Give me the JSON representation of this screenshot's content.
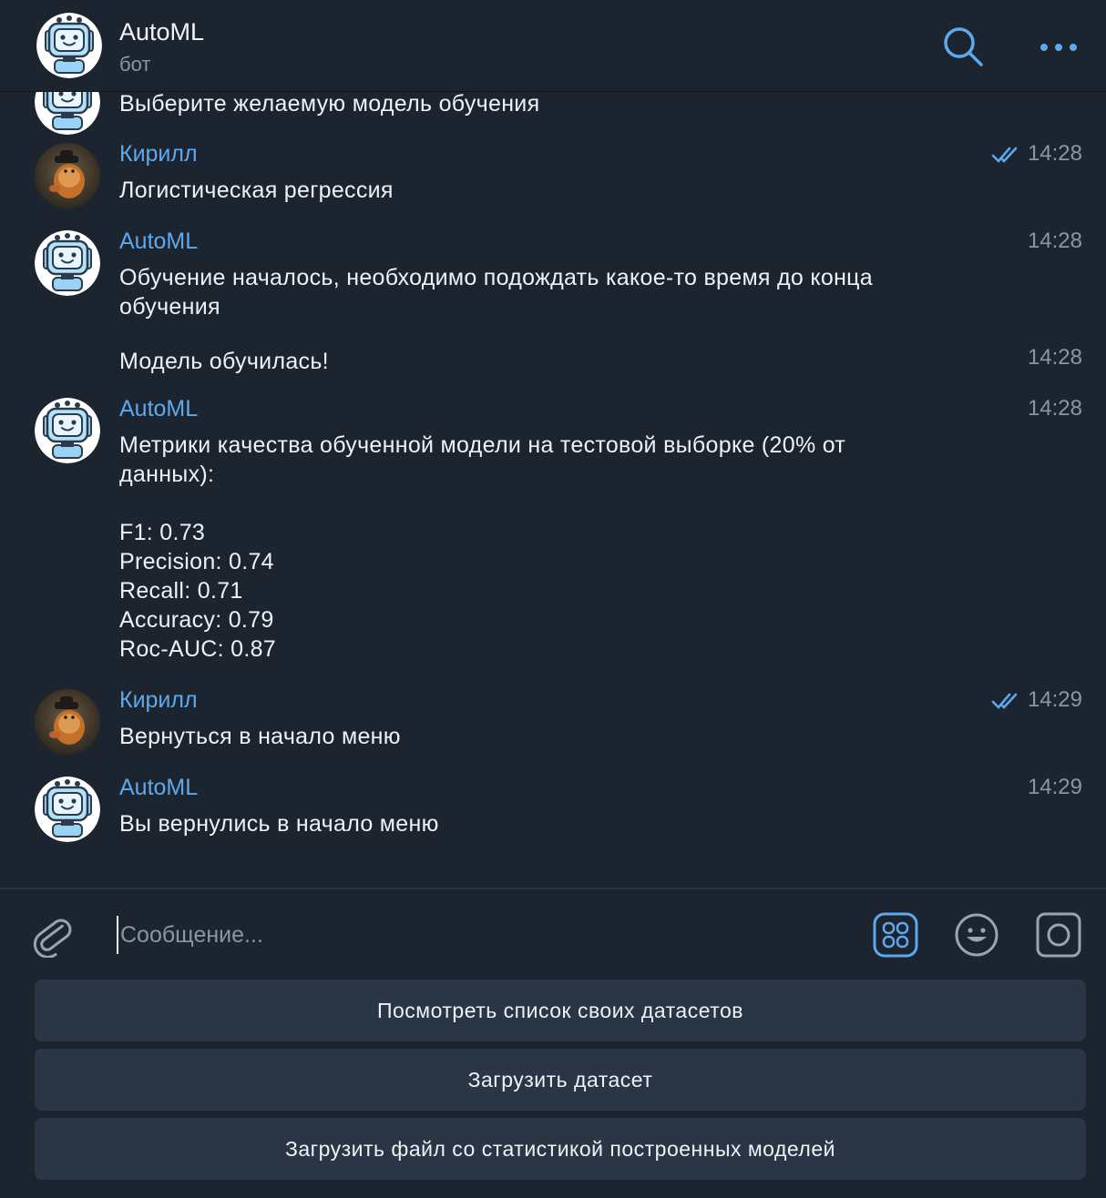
{
  "header": {
    "title": "AutoML",
    "subtitle": "бот",
    "icons": {
      "search": "search-icon",
      "more": "more-icon"
    }
  },
  "messages": [
    {
      "sender": "",
      "text": "Выберите желаемую модель обучения",
      "time": "",
      "avatar": "bot-avatar"
    },
    {
      "sender": "Кирилл",
      "text": "Логистическая регрессия",
      "time": "14:28",
      "read": true,
      "avatar": "user-avatar"
    },
    {
      "sender": "AutoML",
      "text": "Обучение началось, необходимо подождать какое-то время до конца\nобучения",
      "time": "14:28",
      "avatar": "bot-avatar"
    },
    {
      "sender": "",
      "text": "Модель обучилась!",
      "time": "14:28"
    },
    {
      "sender": "AutoML",
      "text": "Метрики качества обученной модели на тестовой выборке (20% от\nданных):\n\nF1: 0.73\nPrecision: 0.74\nRecall: 0.71\nAccuracy: 0.79\nRoc-AUC: 0.87",
      "time": "14:28",
      "avatar": "bot-avatar"
    },
    {
      "sender": "Кирилл",
      "text": "Вернуться в начало меню",
      "time": "14:29",
      "read": true,
      "avatar": "user-avatar"
    },
    {
      "sender": "AutoML",
      "text": "Вы вернулись в начало меню",
      "time": "14:29",
      "avatar": "bot-avatar"
    }
  ],
  "composer": {
    "placeholder": "Сообщение...",
    "icons": [
      "paperclip-icon",
      "bot-keyboard-icon",
      "emoji-icon",
      "video-message-icon"
    ]
  },
  "keyboard": [
    "Посмотреть список своих датасетов",
    "Загрузить датасет",
    "Загрузить файл со статистикой построенных моделей"
  ],
  "colors": {
    "background": "#1c2430",
    "accent": "#5ea9ee",
    "button": "#2a3545",
    "muted": "#8b96a2"
  }
}
